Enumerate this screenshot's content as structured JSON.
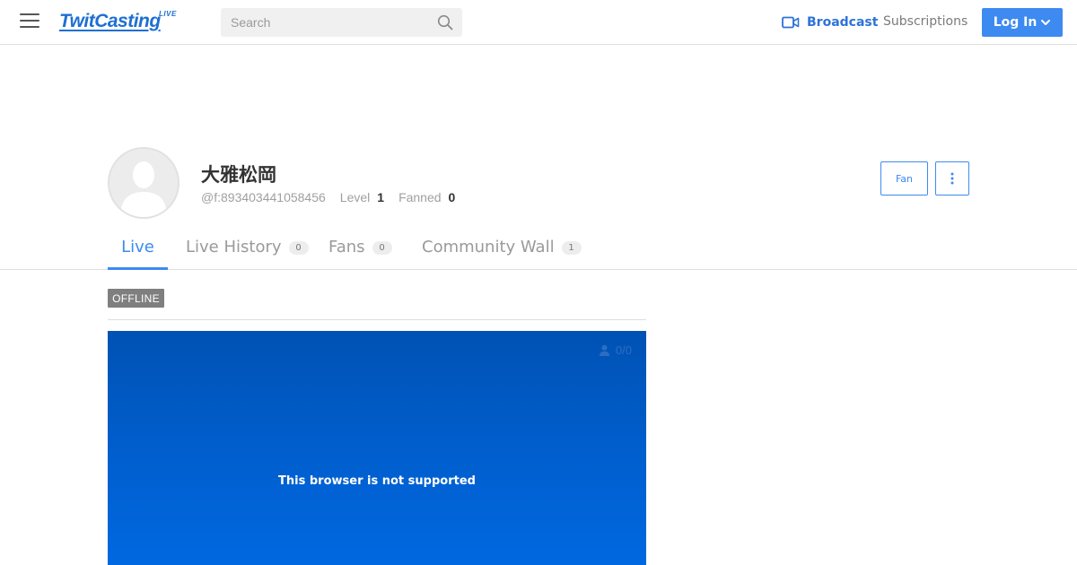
{
  "header": {
    "logo_text": "TwitCasting",
    "logo_badge": "LIVE",
    "search_placeholder": "Search",
    "broadcast_label": "Broadcast",
    "subscriptions_label": "Subscriptions",
    "login_label": "Log In",
    "accent_color": "#3d8af0"
  },
  "profile": {
    "name": "大雅松岡",
    "handle": "@f:893403441058456",
    "level_label": "Level",
    "level_value": "1",
    "fanned_label": "Fanned",
    "fanned_value": "0",
    "fan_button_label": "Fan",
    "more_icon": "vertical-dots-icon"
  },
  "tabs": [
    {
      "label": "Live",
      "count": "",
      "active": true
    },
    {
      "label": "Live History",
      "count": "0",
      "active": false
    },
    {
      "label": "Fans",
      "count": "0",
      "active": false
    },
    {
      "label": "Community Wall",
      "count": "1",
      "active": false
    }
  ],
  "live": {
    "status_badge": "OFFLINE",
    "viewers": "0/0",
    "message": "This browser is not supported"
  }
}
